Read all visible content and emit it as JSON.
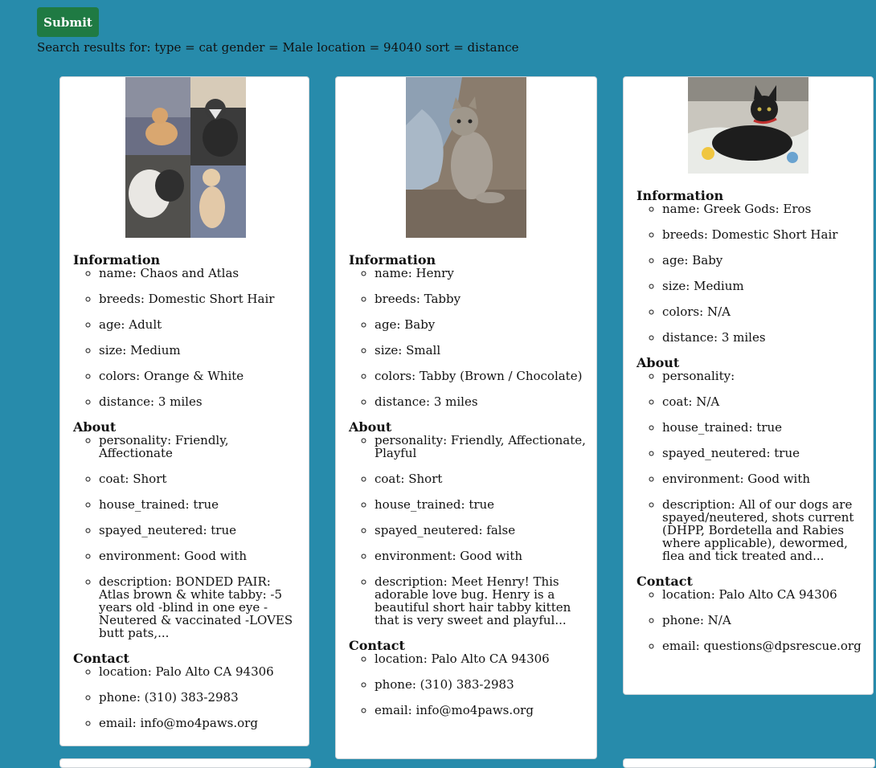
{
  "form": {
    "submit_label": "Submit",
    "search_summary": "Search results for: type = cat gender = Male location = 94040 sort = distance"
  },
  "section_labels": {
    "information": "Information",
    "about": "About",
    "contact": "Contact"
  },
  "cards": [
    {
      "photo_alt": "Collage of orange & white and brown & white tabby cats",
      "information": [
        "name: Chaos and Atlas",
        "breeds: Domestic Short Hair",
        "age: Adult",
        "size: Medium",
        "colors: Orange & White",
        "distance: 3 miles"
      ],
      "about": [
        "personality: Friendly, Affectionate",
        "coat: Short",
        "house_trained: true",
        "spayed_neutered: true",
        "environment: Good with",
        "description: BONDED PAIR: Atlas brown & white tabby: -5 years old -blind in one eye -Neutered & vaccinated -LOVES butt pats,..."
      ],
      "contact": [
        "location: Palo Alto CA 94306",
        "phone: (310) 383-2983",
        "email: info@mo4paws.org"
      ]
    },
    {
      "photo_alt": "Grey tabby kitten lying on carpet",
      "information": [
        "name: Henry",
        "breeds: Tabby",
        "age: Baby",
        "size: Small",
        "colors: Tabby (Brown / Chocolate)",
        "distance: 3 miles"
      ],
      "about": [
        "personality: Friendly, Affectionate, Playful",
        "coat: Short",
        "house_trained: true",
        "spayed_neutered: false",
        "environment: Good with",
        "description: Meet Henry! This adorable love bug. Henry is a beautiful short hair tabby kitten that is very sweet and playful..."
      ],
      "contact": [
        "location: Palo Alto CA 94306",
        "phone: (310) 383-2983",
        "email: info@mo4paws.org"
      ]
    },
    {
      "photo_alt": "Black kitten with red collar lying on blanket",
      "information": [
        "name: Greek Gods: Eros",
        "breeds: Domestic Short Hair",
        "age: Baby",
        "size: Medium",
        "colors: N/A",
        "distance: 3 miles"
      ],
      "about": [
        "personality:",
        "coat: N/A",
        "house_trained: true",
        "spayed_neutered: true",
        "environment: Good with",
        "description: All of our dogs are spayed/neutered, shots current (DHPP, Bordetella and Rabies where applicable), dewormed, flea and tick treated and..."
      ],
      "contact": [
        "location: Palo Alto CA 94306",
        "phone: N/A",
        "email: questions@dpsrescue.org"
      ]
    }
  ],
  "colors": {
    "page_background": "#278bab",
    "submit_button": "#1f7a43",
    "card_background": "#ffffff"
  }
}
